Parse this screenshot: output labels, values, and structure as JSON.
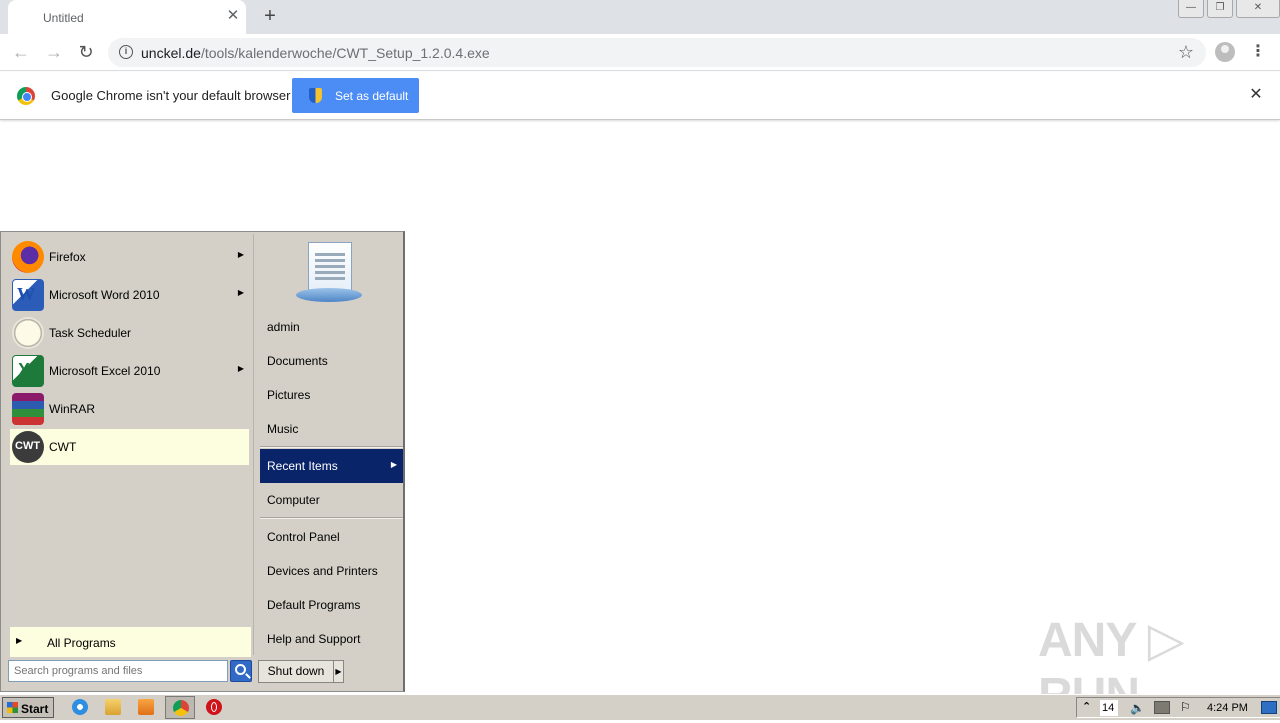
{
  "browser": {
    "tab": {
      "title": "Untitled",
      "close": "✕"
    },
    "new_tab": "+",
    "window": {
      "minimize": "—",
      "restore": "❐",
      "close": "✕"
    },
    "nav": {
      "back": "←",
      "forward": "→",
      "reload": "↻"
    },
    "url_host": "unckel.de",
    "url_path": "/tools/kalenderwoche/CWT_Setup_1.2.0.4.exe",
    "star": "☆",
    "menu": "⋮"
  },
  "infobar": {
    "message": "Google Chrome isn't your default browser",
    "button": "Set as default",
    "close": "✕"
  },
  "start_menu": {
    "programs": [
      {
        "label": "Firefox",
        "icon": "firefox-icon",
        "submenu": true
      },
      {
        "label": "Microsoft Word 2010",
        "icon": "word-icon",
        "submenu": true
      },
      {
        "label": "Task Scheduler",
        "icon": "task-scheduler-icon",
        "submenu": false
      },
      {
        "label": "Microsoft Excel 2010",
        "icon": "excel-icon",
        "submenu": true
      },
      {
        "label": "WinRAR",
        "icon": "winrar-icon",
        "submenu": false
      },
      {
        "label": "CWT",
        "icon": "cwt-icon",
        "submenu": false,
        "highlighted": true
      }
    ],
    "arrow": "▶",
    "all_programs": "All Programs",
    "search_placeholder": "Search programs and files",
    "right_items": [
      {
        "label": "admin"
      },
      {
        "label": "Documents"
      },
      {
        "label": "Pictures"
      },
      {
        "label": "Music"
      },
      {
        "label": "Recent Items",
        "selected": true,
        "submenu": true
      },
      {
        "label": "Computer"
      },
      {
        "label": "Control Panel"
      },
      {
        "label": "Devices and Printers"
      },
      {
        "label": "Default Programs"
      },
      {
        "label": "Help and Support"
      }
    ],
    "shutdown": "Shut down"
  },
  "watermark": "ANY ▷ RUN",
  "taskbar": {
    "start": "Start",
    "tray": {
      "up": "⌃",
      "number": "14",
      "volume": "🔈",
      "flag": "⚐",
      "clock": "4:24 PM"
    }
  },
  "colors": {
    "chrome_blue": "#4b8cf5",
    "selected": "#0a246a",
    "highlight": "#fdfde0"
  }
}
